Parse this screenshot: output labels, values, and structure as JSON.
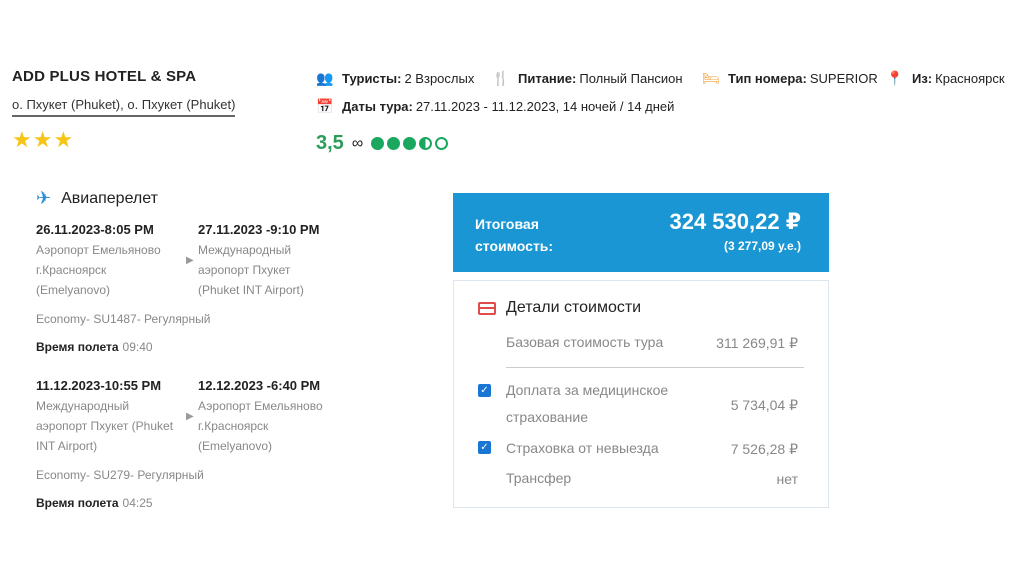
{
  "hotel": {
    "name": "ADD PLUS HOTEL & SPA",
    "location": "о. Пхукет (Phuket), о. Пхукет (Phuket)",
    "stars": 3
  },
  "info": {
    "tourists_label": "Туристы:",
    "tourists_value": "2 Взрослых",
    "meals_label": "Питание:",
    "meals_value": "Полный Пансион",
    "room_label": "Тип номера:",
    "room_value": "SUPERIOR",
    "from_label": "Из:",
    "from_value": "Красноярск",
    "dates_label": "Даты тура:",
    "dates_value": "27.11.2023 - 11.12.2023, 14 ночей / 14 дней"
  },
  "rating": {
    "value": "3,5",
    "bubbles_filled": 3.5
  },
  "flight": {
    "title": "Авиаперелет",
    "legs": [
      {
        "dep_time": "26.11.2023-8:05 PM",
        "dep_addr": [
          "Аэропорт Емельяново",
          "г.Красноярск",
          "(Emelyanovo)"
        ],
        "arr_time": "27.11.2023 -9:10 PM",
        "arr_addr": [
          "Международный",
          "аэропорт Пхукет",
          "(Phuket INT Airport)"
        ],
        "class": "Economy- SU1487- Регулярный",
        "duration_label": "Время полета",
        "duration": "09:40"
      },
      {
        "dep_time": "11.12.2023-10:55 PM",
        "dep_addr": [
          "Международный",
          "аэропорт Пхукет (Phuket",
          "INT Airport)"
        ],
        "arr_time": "12.12.2023 -6:40 PM",
        "arr_addr": [
          "Аэропорт Емельяново",
          "г.Красноярск",
          "(Emelyanovo)"
        ],
        "class": "Economy- SU279- Регулярный",
        "duration_label": "Время полета",
        "duration": "04:25"
      }
    ]
  },
  "total": {
    "label_line1": "Итоговая",
    "label_line2": "стоимость:",
    "price": "324 530,22 ₽",
    "sub": "(3 277,09 у.е.)",
    "color": "#1996d3"
  },
  "details": {
    "title": "Детали стоимости",
    "base_label": "Базовая стоимость тура",
    "base_value": "311 269,91 ₽",
    "med_label_1": "Доплата за медицинское",
    "med_label_2": "страхование",
    "med_value": "5 734,04 ₽",
    "cancel_label": "Страховка от невыезда",
    "cancel_value": "7 526,28 ₽",
    "transfer_label": "Трансфер",
    "transfer_value": "нет"
  }
}
